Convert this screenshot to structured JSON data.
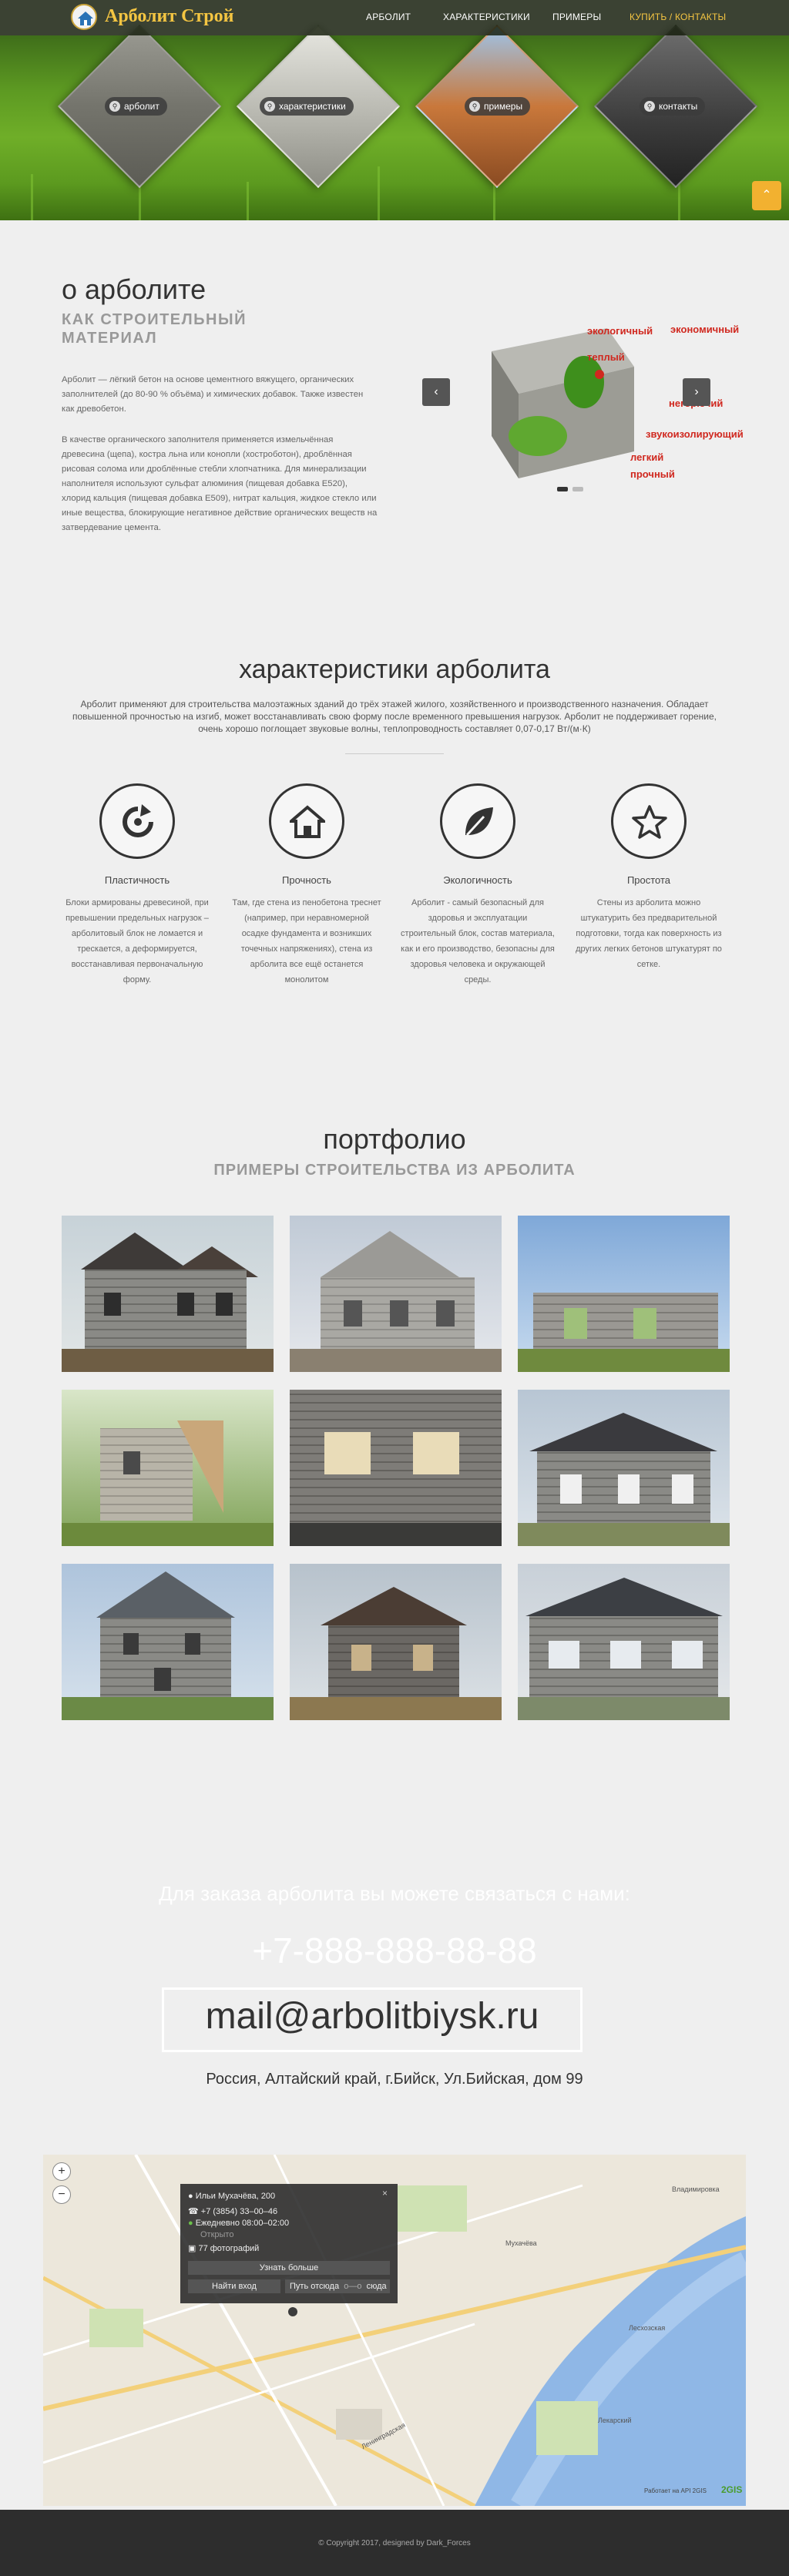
{
  "brand": {
    "name": "Арболит Строй",
    "logo_icon": "house-logo-icon"
  },
  "nav": {
    "items": [
      "АРБОЛИТ",
      "ХАРАКТЕРИСТИКИ",
      "ПРИМЕРЫ",
      "КУПИТЬ / КОНТАКТЫ"
    ],
    "accent": "#f4c542"
  },
  "hero": {
    "tiles": [
      {
        "label": "арболит",
        "icon": "search-icon"
      },
      {
        "label": "характеристики",
        "icon": "search-icon"
      },
      {
        "label": "примеры",
        "icon": "search-icon"
      },
      {
        "label": "контакты",
        "icon": "search-icon"
      }
    ],
    "scroll_top_icon": "chevron-up-icon"
  },
  "about": {
    "title": "о арболите",
    "subtitle": "КАК СТРОИТЕЛЬНЫЙ МАТЕРИАЛ",
    "p1": "Арболит — лёгкий бетон на основе цементного вяжущего, органических заполнителей (до 80-90 % объёма) и химических добавок. Также известен как древобетон.",
    "p2": "В качестве органического заполнителя применяется измельчённая древесина (щепа), костра льна или конопли (хостроботон), дроблённая рисовая солома или дроблённые стебли хлопчатника. Для минерализации наполнителя используют сульфат алюминия (пищевая добавка E520), хлорид кальция (пищевая добавка E509), нитрат кальция, жидкое стекло или иные вещества, блокирующие негативное действие органических веществ на затвердевание цемента.",
    "slider": {
      "tags": [
        "экологичный",
        "экономичный",
        "теплый",
        "негорючий",
        "звукоизолирующий",
        "легкий",
        "прочный"
      ],
      "prev_icon": "chevron-left-icon",
      "next_icon": "chevron-right-icon"
    }
  },
  "characteristics": {
    "title": "характеристики арболита",
    "description": "Арболит применяют для строительства малоэтажных зданий до трёх этажей жилого, хозяйственного и производственного назначения. Обладает повышенной прочностью на изгиб, может восстанавливать свою форму после временного превышения нагрузок. Арболит не поддерживает горение, очень хорошо поглощает звуковые волны, теплопроводность составляет 0,07-0,17 Вт/(м·К)",
    "features": [
      {
        "title": "Пластичность",
        "text": "Блоки армированы древесиной, при превышении предельных нагрузок – арболитовый блок не ломается и трескается, а деформируется, восстанавливая первоначальную форму.",
        "icon": "refresh-icon"
      },
      {
        "title": "Прочность",
        "text": "Там, где стена из пенобетона треснет (например, при неравномерной осадке фундамента и возникших точечных напряжениях), стена из арболита все ещё останется монолитом",
        "icon": "home-icon"
      },
      {
        "title": "Экологичность",
        "text": "Арболит - самый безопасный для здоровья и эксплуатации строительный блок, состав материала, как и его производство, безопасны для здоровья человека и окружающей среды.",
        "icon": "leaf-icon"
      },
      {
        "title": "Простота",
        "text": "Стены из арболита можно штукатурить без предварительной подготовки, тогда как поверхность из других легких бетонов штукатурят по сетке.",
        "icon": "star-icon"
      }
    ]
  },
  "portfolio": {
    "title": "портфолио",
    "subtitle": "ПРИМЕРЫ СТРОИТЕЛЬСТВА ИЗ АРБОЛИТА"
  },
  "contact": {
    "lead": "Для заказа арболита вы можете связаться с нами:",
    "phone": "+7-888-888-88-88",
    "email": "mail@arbolitbiysk.ru",
    "address": "Россия, Алтайский край, г.Бийск, Ул.Бийская, дом 99"
  },
  "map": {
    "zoom_in": "+",
    "zoom_out": "−",
    "popup": {
      "place": "Ильи Мухачёва, 200",
      "phone": "+7 (3854) 33–00–46",
      "hours": "Ежедневно 08:00–02:00",
      "status": "Открыто",
      "photos": "77 фотографий",
      "more": "Узнать больше",
      "entrance": "Найти вход",
      "route": "Путь отсюда",
      "route_to": "сюда",
      "close_icon": "close-icon"
    },
    "streets": [
      "Мухачёва",
      "Владимировка",
      "Лесхозская",
      "Лекарский",
      "Ленинградская"
    ],
    "attribution": "Работает на API 2GIS",
    "gis_logo": "2GIS"
  },
  "footer": {
    "text": "© Copyright 2017, designed by Dark_Forces"
  }
}
